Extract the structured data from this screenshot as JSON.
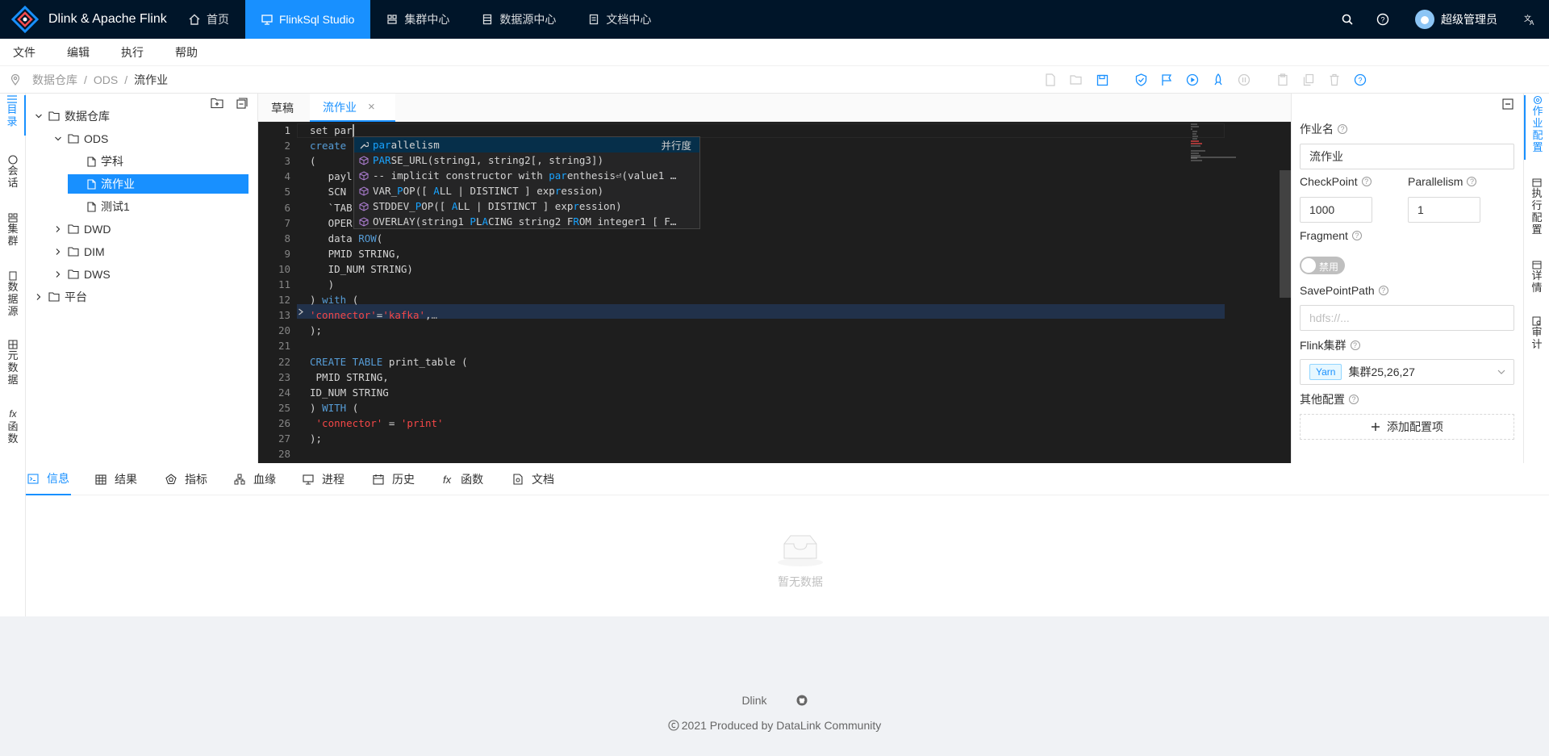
{
  "app": {
    "title": "Dlink & Apache Flink"
  },
  "nav": {
    "items": [
      {
        "label": "首页"
      },
      {
        "label": "FlinkSql Studio"
      },
      {
        "label": "集群中心"
      },
      {
        "label": "数据源中心"
      },
      {
        "label": "文档中心"
      }
    ],
    "active_index": 1
  },
  "user": {
    "name": "超级管理员"
  },
  "menubar": {
    "items": [
      "文件",
      "编辑",
      "执行",
      "帮助"
    ]
  },
  "breadcrumb": {
    "items": [
      "数据仓库",
      "ODS",
      "流作业"
    ]
  },
  "left_tabs": [
    {
      "label": "目录",
      "chars": [
        "目",
        "录"
      ]
    },
    {
      "label": "会话",
      "chars": [
        "会",
        "话"
      ]
    },
    {
      "label": "集群",
      "chars": [
        "集",
        "群"
      ]
    },
    {
      "label": "数据源",
      "chars": [
        "数",
        "据",
        "源"
      ]
    },
    {
      "label": "元数据",
      "chars": [
        "元",
        "数",
        "据"
      ]
    },
    {
      "label": "函数",
      "chars": [
        "函",
        "数"
      ]
    }
  ],
  "tree": {
    "nodes": [
      {
        "label": "数据仓库",
        "level": 0,
        "type": "folder",
        "expanded": true
      },
      {
        "label": "ODS",
        "level": 1,
        "type": "folder",
        "expanded": true
      },
      {
        "label": "学科",
        "level": 2,
        "type": "file"
      },
      {
        "label": "流作业",
        "level": 2,
        "type": "file",
        "selected": true
      },
      {
        "label": "测试1",
        "level": 2,
        "type": "file"
      },
      {
        "label": "DWD",
        "level": 1,
        "type": "folder",
        "expanded": false
      },
      {
        "label": "DIM",
        "level": 1,
        "type": "folder",
        "expanded": false
      },
      {
        "label": "DWS",
        "level": 1,
        "type": "folder",
        "expanded": false
      },
      {
        "label": "平台",
        "level": 0,
        "type": "folder",
        "expanded": false
      }
    ]
  },
  "editor_tabs": [
    {
      "label": "草稿",
      "active": false
    },
    {
      "label": "流作业",
      "active": true,
      "close": "×"
    }
  ],
  "editor": {
    "lines": [
      {
        "num": "1",
        "html": "set par"
      },
      {
        "num": "2",
        "html": "<span class='kw'>create</span>"
      },
      {
        "num": "3",
        "html": "("
      },
      {
        "num": "4",
        "html": "   payl"
      },
      {
        "num": "5",
        "html": "   SCN "
      },
      {
        "num": "6",
        "html": "   `TAB"
      },
      {
        "num": "7",
        "html": "   OPER"
      },
      {
        "num": "8",
        "html": "   data <span class='kw'>ROW</span>("
      },
      {
        "num": "9",
        "html": "   PMID STRING,"
      },
      {
        "num": "10",
        "html": "   ID_NUM STRING)"
      },
      {
        "num": "11",
        "html": "   )"
      },
      {
        "num": "12",
        "html": ") <span class='kw'>with</span> ("
      },
      {
        "num": "13",
        "html": "<span class='red'>'connector'</span>=<span class='red'>'kafka'</span>,<span style='color:#9e9e9e'>…</span>"
      },
      {
        "num": "20",
        "html": ");"
      },
      {
        "num": "21",
        "html": ""
      },
      {
        "num": "22",
        "html": "<span class='kw'>CREATE TABLE</span> print_table ("
      },
      {
        "num": "23",
        "html": " PMID STRING,"
      },
      {
        "num": "24",
        "html": "ID_NUM STRING"
      },
      {
        "num": "25",
        "html": ") <span class='kw'>WITH</span> ("
      },
      {
        "num": "26",
        "html": " <span class='red'>'connector'</span> = <span class='red'>'print'</span>"
      },
      {
        "num": "27",
        "html": ");"
      },
      {
        "num": "28",
        "html": ""
      }
    ],
    "suggestions": [
      {
        "html": "<span class='hl'>par</span>allelism",
        "detail": "并行度",
        "icon": "wrench"
      },
      {
        "html": "<span class='hl'>PAR</span>SE_URL(string1, string2[, string3])",
        "detail": "",
        "icon": "cube"
      },
      {
        "html": "-- implicit constructor with <span class='hl'>par</span>enthesis⏎(value1 …",
        "detail": "",
        "icon": "cube"
      },
      {
        "html": "VAR_<span class='hl'>P</span>OP([ <span class='hl'>A</span>LL | DISTINCT ] exp<span class='hl'>r</span>ession)",
        "detail": "",
        "icon": "cube"
      },
      {
        "html": "STDDEV_<span class='hl'>P</span>OP([ <span class='hl'>A</span>LL | DISTINCT ] exp<span class='hl'>r</span>ession)",
        "detail": "",
        "icon": "cube"
      },
      {
        "html": "OVERLAY(string1 <span class='hl'>P</span>L<span class='hl'>A</span>CING string2 F<span class='hl'>R</span>OM integer1 [ F…",
        "detail": "",
        "icon": "cube"
      }
    ]
  },
  "config": {
    "job_name_label": "作业名",
    "job_name_value": "流作业",
    "checkpoint_label": "CheckPoint",
    "checkpoint_value": "1000",
    "parallelism_label": "Parallelism",
    "parallelism_value": "1",
    "fragment_label": "Fragment",
    "fragment_switch": "禁用",
    "savepoint_label": "SavePointPath",
    "savepoint_placeholder": "hdfs://...",
    "cluster_label": "Flink集群",
    "cluster_tag": "Yarn",
    "cluster_value": "集群25,26,27",
    "other_label": "其他配置",
    "add_button": "添加配置项"
  },
  "right_tabs": [
    {
      "label": "作业配置",
      "chars": [
        "作",
        "业",
        "配",
        "置"
      ]
    },
    {
      "label": "执行配置",
      "chars": [
        "执",
        "行",
        "配",
        "置"
      ]
    },
    {
      "label": "详情",
      "chars": [
        "详",
        "情"
      ]
    },
    {
      "label": "审计",
      "chars": [
        "审",
        "计"
      ]
    }
  ],
  "bottom_tabs": [
    {
      "label": "信息"
    },
    {
      "label": "结果"
    },
    {
      "label": "指标"
    },
    {
      "label": "血缘"
    },
    {
      "label": "进程"
    },
    {
      "label": "历史"
    },
    {
      "label": "函数"
    },
    {
      "label": "文档"
    }
  ],
  "empty_text": "暂无数据",
  "footer": {
    "link": "Dlink",
    "copyright": "2021 Produced by DataLink Community"
  },
  "colors": {
    "primary": "#1890ff",
    "header_bg": "#001529",
    "editor_bg": "#1e1e1e"
  }
}
